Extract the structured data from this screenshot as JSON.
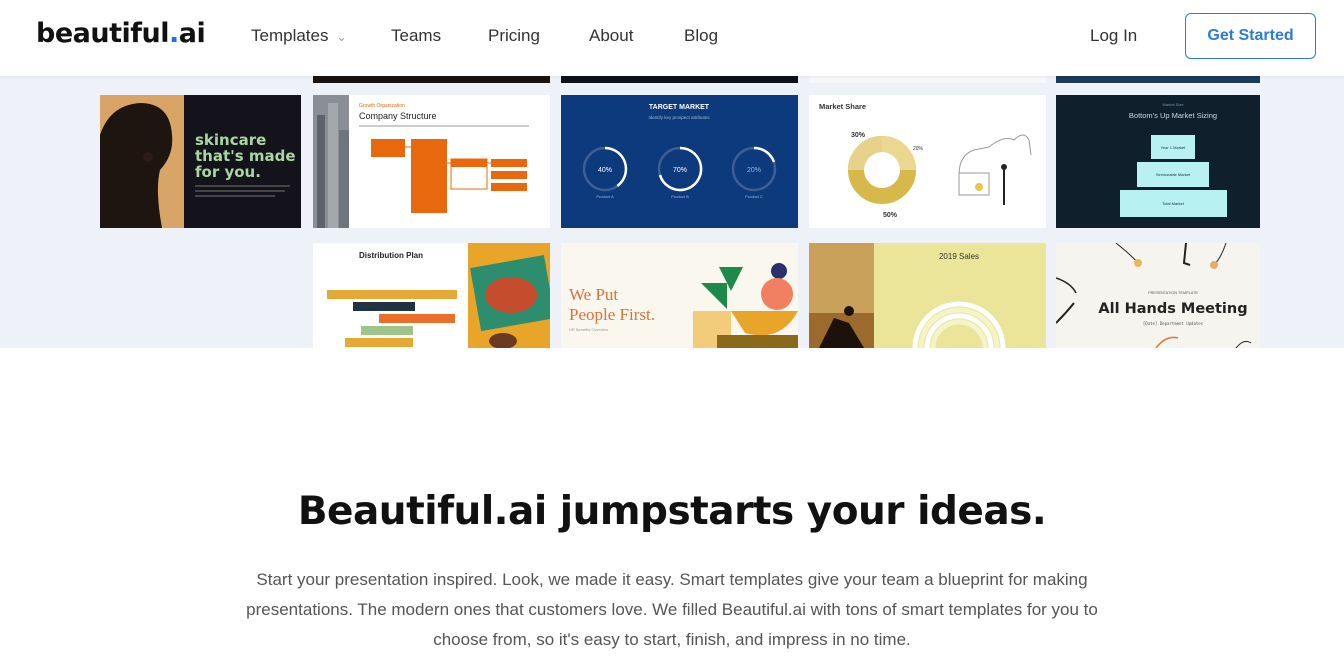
{
  "nav": {
    "logo_main": "beautiful",
    "logo_dot": ".",
    "logo_tld": "ai",
    "links": [
      "Templates",
      "Teams",
      "Pricing",
      "About",
      "Blog"
    ],
    "login": "Log In",
    "cta": "Get Started"
  },
  "gallery": {
    "skincare": {
      "title_lines": [
        "skincare",
        "that's made",
        "for you."
      ]
    },
    "company": {
      "kicker": "Growth Organization",
      "title": "Company Structure"
    },
    "target": {
      "title": "TARGET MARKET",
      "subtitle": "Identify key prospect attributes",
      "circles": [
        {
          "value": "40%",
          "label": "Product A"
        },
        {
          "value": "70%",
          "label": "Product B"
        },
        {
          "value": "20%",
          "label": "Product C"
        }
      ]
    },
    "share": {
      "title": "Market Share",
      "labels": [
        "30%",
        "20%",
        "50%"
      ]
    },
    "sizing": {
      "kicker": "Market Size",
      "title": "Bottom's Up Market Sizing",
      "tiers": [
        "Year 1 Market",
        "Serviceable Market",
        "Total Market"
      ]
    },
    "distribution": {
      "title": "Distribution Plan"
    },
    "weput": {
      "line1": "We Put",
      "line2": "People First.",
      "sub": "HR Benefits Overview"
    },
    "sales": {
      "title": "2019 Sales"
    },
    "allhands": {
      "kicker": "PRESENTATION TEMPLATE",
      "title": "All Hands Meeting",
      "sub": "[Date] Department Updates"
    }
  },
  "hero": {
    "headline": "Beautiful.ai jumpstarts your ideas.",
    "body": "Start your presentation inspired. Look, we made it easy. Smart templates give your team a blueprint for making presentations. The modern ones that customers love. We filled Beautiful.ai with tons of smart templates for you to choose from, so it's easy to start, finish, and impress in no time."
  },
  "colors": {
    "accent": "#2d7bd8",
    "navy": "#0d3a7c",
    "orange": "#e8690d",
    "dark": "#0f1f2c",
    "gallery_bg": "#eef2f8"
  }
}
